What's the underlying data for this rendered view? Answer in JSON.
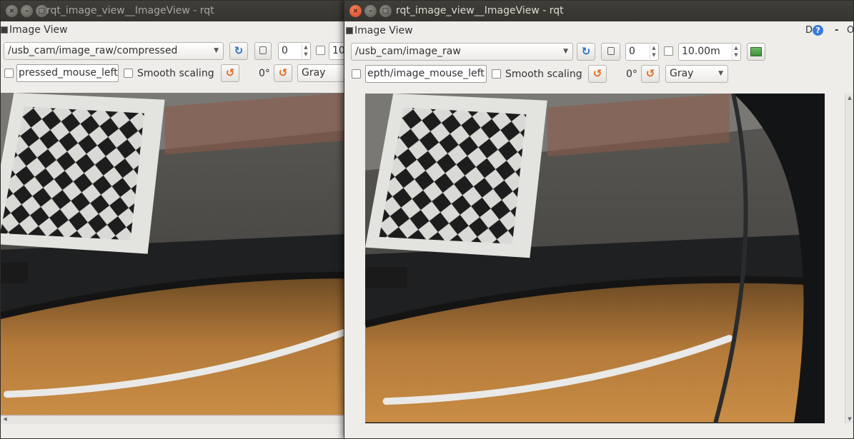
{
  "left_window": {
    "title": "rqt_image_view__ImageView - rqt",
    "panel_label": "Image View",
    "topic": "/usb_cam/image_raw/compressed",
    "spin_value": "0",
    "next_value_partial": "10",
    "mouse_topic": "pressed_mouse_left",
    "smooth_scaling_label": "Smooth scaling",
    "rotation": "0°",
    "color_scheme": "Gray"
  },
  "right_window": {
    "title": "rqt_image_view__ImageView - rqt",
    "panel_label": "Image View",
    "topic": "/usb_cam/image_raw",
    "spin_value": "0",
    "max_range": "10.00m",
    "mouse_topic": "epth/image_mouse_left",
    "smooth_scaling_label": "Smooth scaling",
    "rotation": "0°",
    "color_scheme": "Gray",
    "help_d": "D",
    "help_q": "?",
    "minimize": "-",
    "close_partial": "O"
  },
  "icons": {
    "refresh": "↻",
    "rotate": "↺",
    "close": "×",
    "minimize": "–",
    "maximize": "□"
  }
}
